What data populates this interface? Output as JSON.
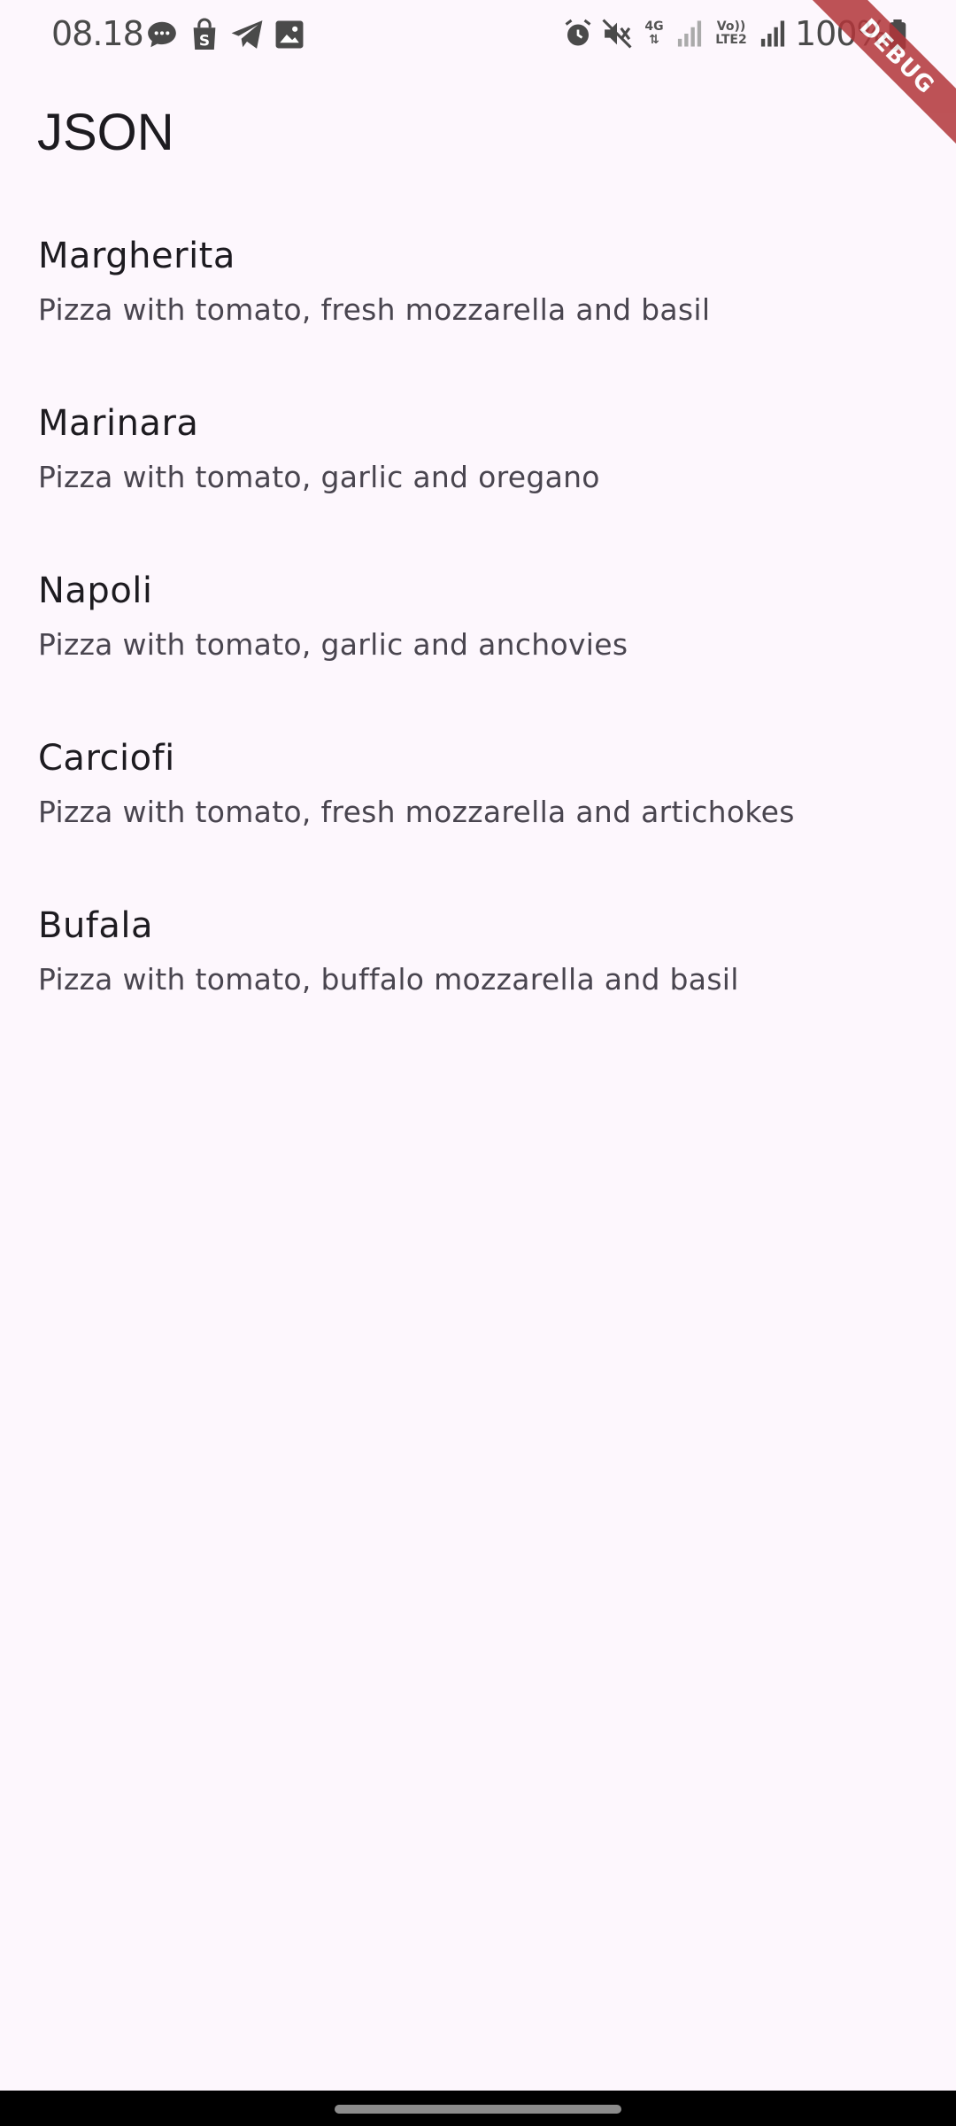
{
  "status_bar": {
    "time": "08.18",
    "battery": "100%",
    "network_4g": "4G",
    "volte_top": "Vo))",
    "volte_bottom": "LTE2",
    "left_icons": [
      "chat-bubble-icon",
      "shopping-bag-icon",
      "telegram-icon",
      "image-icon"
    ],
    "right_icons": [
      "alarm-icon",
      "mute-icon",
      "network-4g-icon",
      "signal-icon",
      "volte-icon",
      "signal-icon",
      "battery-icon"
    ]
  },
  "debug_banner": {
    "label": "DEBUG",
    "color": "#b2363a"
  },
  "app_bar": {
    "title": "JSON"
  },
  "pizzas": [
    {
      "name": "Margherita",
      "description": "Pizza with tomato, fresh mozzarella and basil"
    },
    {
      "name": "Marinara",
      "description": "Pizza with tomato, garlic and oregano"
    },
    {
      "name": "Napoli",
      "description": "Pizza with tomato, garlic and anchovies"
    },
    {
      "name": "Carciofi",
      "description": "Pizza with tomato, fresh mozzarella and artichokes"
    },
    {
      "name": "Bufala",
      "description": "Pizza with tomato, buffalo mozzarella and basil"
    }
  ],
  "colors": {
    "background": "#fdf7fd",
    "title_text": "#1d1b20",
    "subtitle_text": "#49454f"
  }
}
